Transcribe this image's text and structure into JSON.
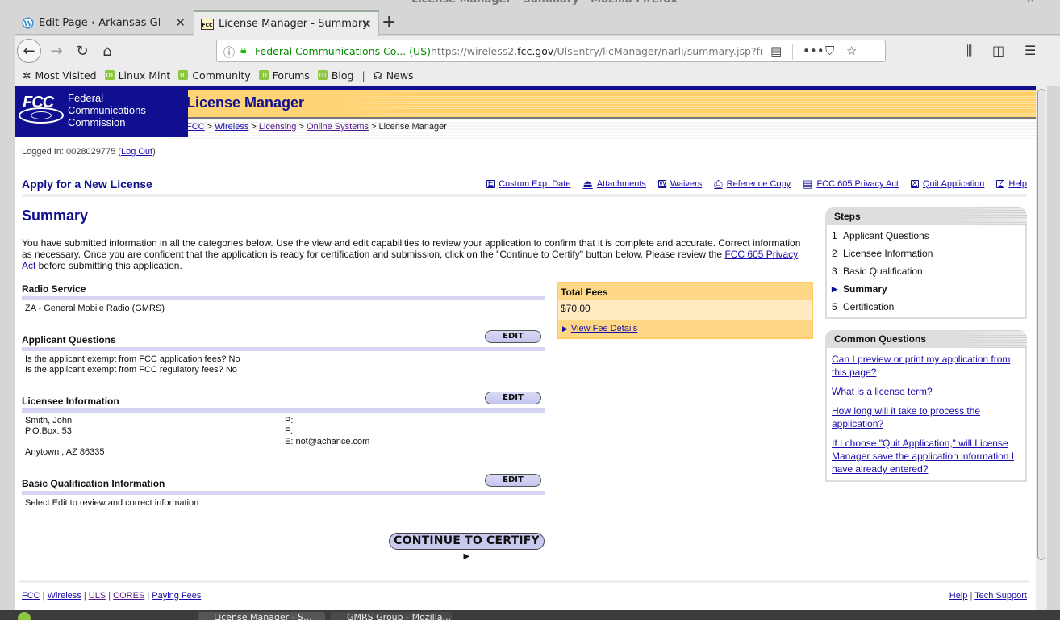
{
  "window": {
    "title": "License Manager - Summary - Mozilla Firefox"
  },
  "browser": {
    "tabs": [
      {
        "label": "Edit Page ‹ Arkansas GMRS Sy",
        "icon": "wordpress-icon",
        "active": false
      },
      {
        "label": "License Manager - Summary",
        "icon": "fcc-favicon",
        "active": true
      }
    ],
    "new_tab": "+",
    "url_org": "Federal Communications Co...  (US)",
    "url_prefix": "https://wireless2.",
    "url_domain": "fcc.gov",
    "url_path": "/UlsEntry/licManager/narli/summary.jsp?fron",
    "bookmarks": [
      {
        "label": "Most Visited",
        "icon": "gear-icon"
      },
      {
        "label": "Linux Mint",
        "icon": "mint-icon"
      },
      {
        "label": "Community",
        "icon": "mint-icon"
      },
      {
        "label": "Forums",
        "icon": "mint-icon"
      },
      {
        "label": "Blog",
        "icon": "mint-icon"
      },
      {
        "label": "News",
        "icon": "rss-icon"
      }
    ]
  },
  "header": {
    "logo_abbr": "FCC",
    "logo_lines": [
      "Federal",
      "Communications",
      "Commission"
    ],
    "app_title": "License Manager",
    "breadcrumb": [
      {
        "label": "FCC",
        "link": true
      },
      {
        "label": "Wireless",
        "link": true
      },
      {
        "label": "Licensing",
        "link": true
      },
      {
        "label": "Online Systems",
        "link": true
      },
      {
        "label": "License Manager",
        "link": false
      }
    ],
    "separator": ">"
  },
  "session": {
    "logged_in_label": "Logged In: 0028029775 (",
    "logout": "Log Out",
    "close_paren": ")"
  },
  "toolbar": {
    "title": "Apply for a New License",
    "links": [
      {
        "label": "Custom Exp. Date",
        "icon": "E"
      },
      {
        "label": "Attachments",
        "icon": "⏏"
      },
      {
        "label": "Waivers",
        "icon": "W"
      },
      {
        "label": "Reference Copy",
        "icon": "⎙"
      },
      {
        "label": "FCC 605 Privacy Act",
        "icon": "▤"
      },
      {
        "label": "Quit Application",
        "icon": "X"
      },
      {
        "label": "Help",
        "icon": "?"
      }
    ]
  },
  "main": {
    "title": "Summary",
    "intro_text": "You have submitted information in all the categories below. Use the view and edit capabilities to review your application to confirm that it is complete and accurate. Correct information as necessary. Once you are confident that the application is ready for certification and submission, click on the \"Continue to Certify\" button below. Please review the ",
    "intro_link": "FCC 605 Privacy Act",
    "intro_tail": " before submitting this application.",
    "edit_label": "EDIT",
    "sections": {
      "radio_service": {
        "heading": "Radio Service",
        "value": "ZA - General Mobile Radio (GMRS)"
      },
      "applicant_questions": {
        "heading": "Applicant Questions",
        "lines": [
          "Is the applicant exempt from FCC application fees? No",
          "Is the applicant exempt from FCC regulatory fees? No"
        ]
      },
      "licensee_information": {
        "heading": "Licensee Information",
        "name": "Smith, John",
        "address": "P.O.Box: 53",
        "city": "Anytown , AZ 86335",
        "phone": "P:",
        "fax": "F:",
        "email": "E: not@achance.com"
      },
      "basic_qualification": {
        "heading": "Basic Qualification Information",
        "value": "Select Edit to review and correct information"
      }
    },
    "continue_button": "CONTINUE TO CERTIFY"
  },
  "fees": {
    "heading": "Total Fees",
    "amount": "$70.00",
    "details_link": "View Fee Details"
  },
  "steps": {
    "heading": "Steps",
    "items": [
      {
        "num": "1",
        "label": "Applicant Questions",
        "current": false
      },
      {
        "num": "2",
        "label": "Licensee Information",
        "current": false
      },
      {
        "num": "3",
        "label": "Basic Qualification",
        "current": false
      },
      {
        "num": "",
        "label": "Summary",
        "current": true
      },
      {
        "num": "5",
        "label": "Certification",
        "current": false
      }
    ]
  },
  "common_questions": {
    "heading": "Common Questions",
    "items": [
      "Can I preview or print my application from this page?",
      "What is a license term?",
      "How long will it take to process the application?",
      "If I choose \"Quit Application,\" will License Manager save the application information I have already entered?"
    ]
  },
  "footer": {
    "left_links": [
      "FCC",
      "Wireless",
      "ULS",
      "CORES",
      "Paying Fees"
    ],
    "right_links": [
      "Help",
      "Tech Support"
    ],
    "separator": "|"
  },
  "taskbar": {
    "windows": [
      "License Manager - S...",
      "GMRS Group - Mozilla..."
    ]
  }
}
